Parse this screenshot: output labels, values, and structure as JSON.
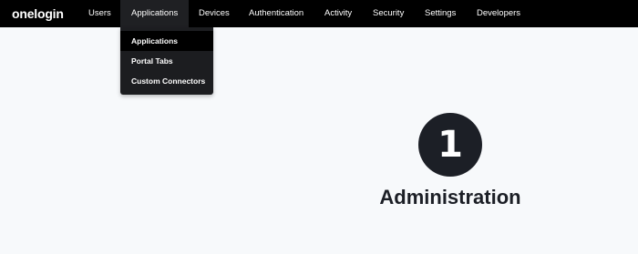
{
  "brand": {
    "logo": "onelogin"
  },
  "nav": {
    "items": [
      {
        "label": "Users"
      },
      {
        "label": "Applications"
      },
      {
        "label": "Devices"
      },
      {
        "label": "Authentication"
      },
      {
        "label": "Activity"
      },
      {
        "label": "Security"
      },
      {
        "label": "Settings"
      },
      {
        "label": "Developers"
      }
    ],
    "active_index": 1
  },
  "dropdown": {
    "items": [
      {
        "label": "Applications",
        "selected": true
      },
      {
        "label": "Portal Tabs",
        "selected": false
      },
      {
        "label": "Custom Connectors",
        "selected": false
      }
    ]
  },
  "step": {
    "number": "1",
    "title": "Administration"
  },
  "colors": {
    "topbar": "#000000",
    "active_nav": "#1f2023",
    "dropdown_bg": "#1c1d20",
    "page_bg": "#f7f9fb",
    "circle": "#1c1f26"
  }
}
